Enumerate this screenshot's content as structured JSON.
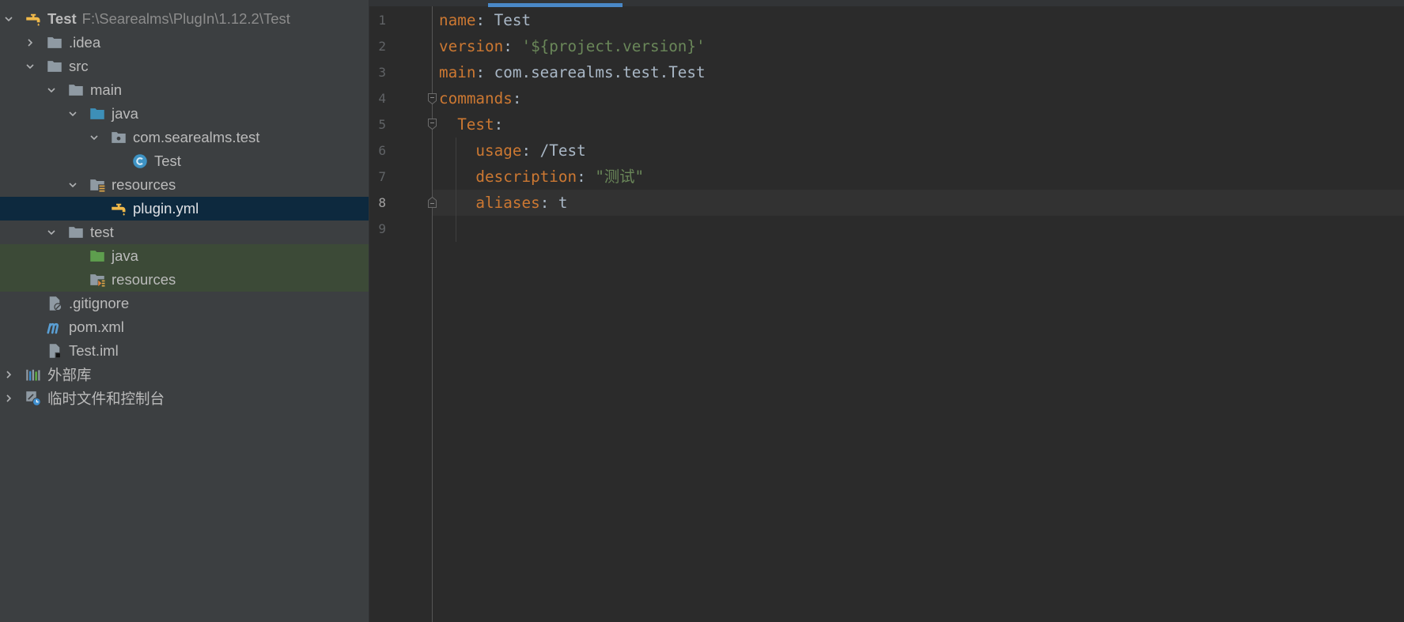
{
  "project_tree": {
    "label": "Test",
    "path": "F:\\Searealms\\PlugIn\\1.12.2\\Test",
    "icon": "plugin-module-icon",
    "expanded": true,
    "children": [
      {
        "label": ".idea",
        "icon": "folder-icon",
        "expanded": false
      },
      {
        "label": "src",
        "icon": "folder-icon",
        "expanded": true,
        "children": [
          {
            "label": "main",
            "icon": "folder-icon",
            "expanded": true,
            "children": [
              {
                "label": "java",
                "icon": "source-root-folder-icon",
                "expanded": true,
                "children": [
                  {
                    "label": "com.searealms.test",
                    "icon": "package-icon",
                    "expanded": true,
                    "children": [
                      {
                        "label": "Test",
                        "icon": "class-icon"
                      }
                    ]
                  }
                ]
              },
              {
                "label": "resources",
                "icon": "resources-folder-icon",
                "expanded": true,
                "children": [
                  {
                    "label": "plugin.yml",
                    "icon": "plugin-yml-icon",
                    "selected": true
                  }
                ]
              }
            ]
          },
          {
            "label": "test",
            "icon": "folder-icon",
            "expanded": true,
            "children": [
              {
                "label": "java",
                "icon": "test-source-folder-icon"
              },
              {
                "label": "resources",
                "icon": "test-resources-folder-icon"
              }
            ]
          }
        ]
      },
      {
        "label": ".gitignore",
        "icon": "gitignore-file-icon"
      },
      {
        "label": "pom.xml",
        "icon": "maven-icon"
      },
      {
        "label": "Test.iml",
        "icon": "iml-file-icon"
      }
    ]
  },
  "tree_extra": [
    {
      "label": "外部库",
      "icon": "library-icon",
      "expanded": false
    },
    {
      "label": "临时文件和控制台",
      "icon": "scratches-icon",
      "expanded": false
    }
  ],
  "editor": {
    "current_line": 8,
    "lines": [
      {
        "number": "1",
        "key": "name",
        "colon": ":",
        "value": "Test"
      },
      {
        "number": "2",
        "key": "version",
        "colon": ":",
        "value": "'${project.version}'"
      },
      {
        "number": "3",
        "key": "main",
        "colon": ":",
        "value": "com.searealms.test.Test"
      },
      {
        "number": "4",
        "key": "commands",
        "colon": ":"
      },
      {
        "number": "5",
        "key": "Test",
        "colon": ":"
      },
      {
        "number": "6",
        "key": "usage",
        "colon": ":",
        "value": "/Test"
      },
      {
        "number": "7",
        "key": "description",
        "colon": ":",
        "value": "\"测试\""
      },
      {
        "number": "8",
        "key": "aliases",
        "colon": ":",
        "value": "t"
      },
      {
        "number": "9"
      }
    ]
  },
  "colors": {
    "panel_bg": "#3c3f41",
    "editor_bg": "#2b2b2b",
    "selection_bg": "#0d293e",
    "test_scope_bg": "#3c4a37",
    "yaml_key": "#cc7832",
    "yaml_string": "#6a8759",
    "accent": "#4a88c7"
  }
}
